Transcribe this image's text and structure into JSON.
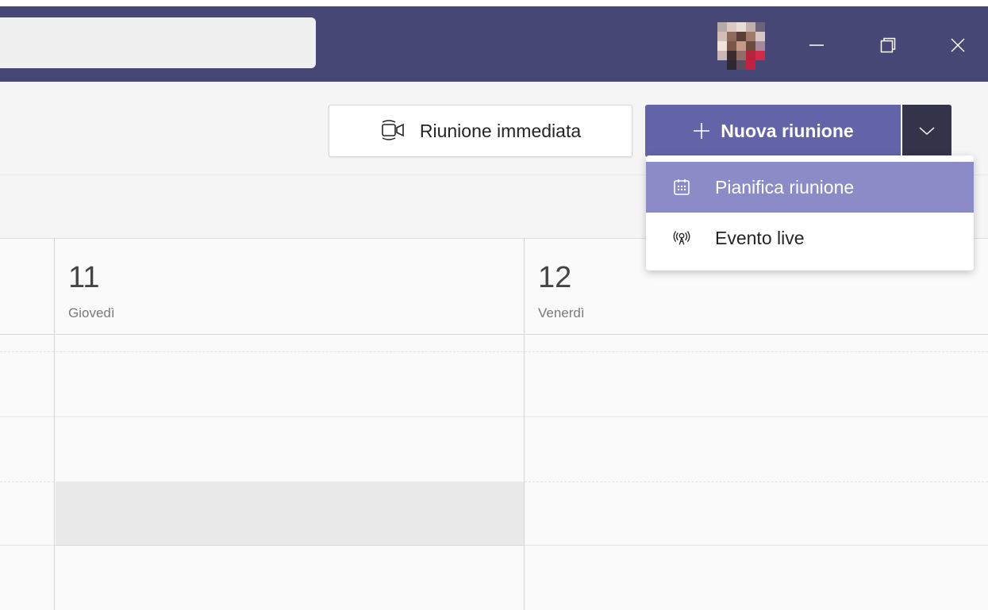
{
  "search": {
    "value": "",
    "placeholder": ""
  },
  "toolbar": {
    "meet_now_label": "Riunione immediata",
    "new_meeting_label": "Nuova riunione"
  },
  "dropdown": {
    "items": [
      {
        "label": "Pianifica riunione",
        "icon": "calendar-icon",
        "active": true
      },
      {
        "label": "Evento live",
        "icon": "live-broadcast-icon",
        "active": false
      }
    ]
  },
  "calendar": {
    "days": [
      {
        "number": "11",
        "name": "Giovedì"
      },
      {
        "number": "12",
        "name": "Venerdì"
      }
    ]
  },
  "colors": {
    "titlebar": "#464775",
    "brand": "#6264a7",
    "brand_dark": "#33344a",
    "menu_active": "#8b8cc7"
  }
}
